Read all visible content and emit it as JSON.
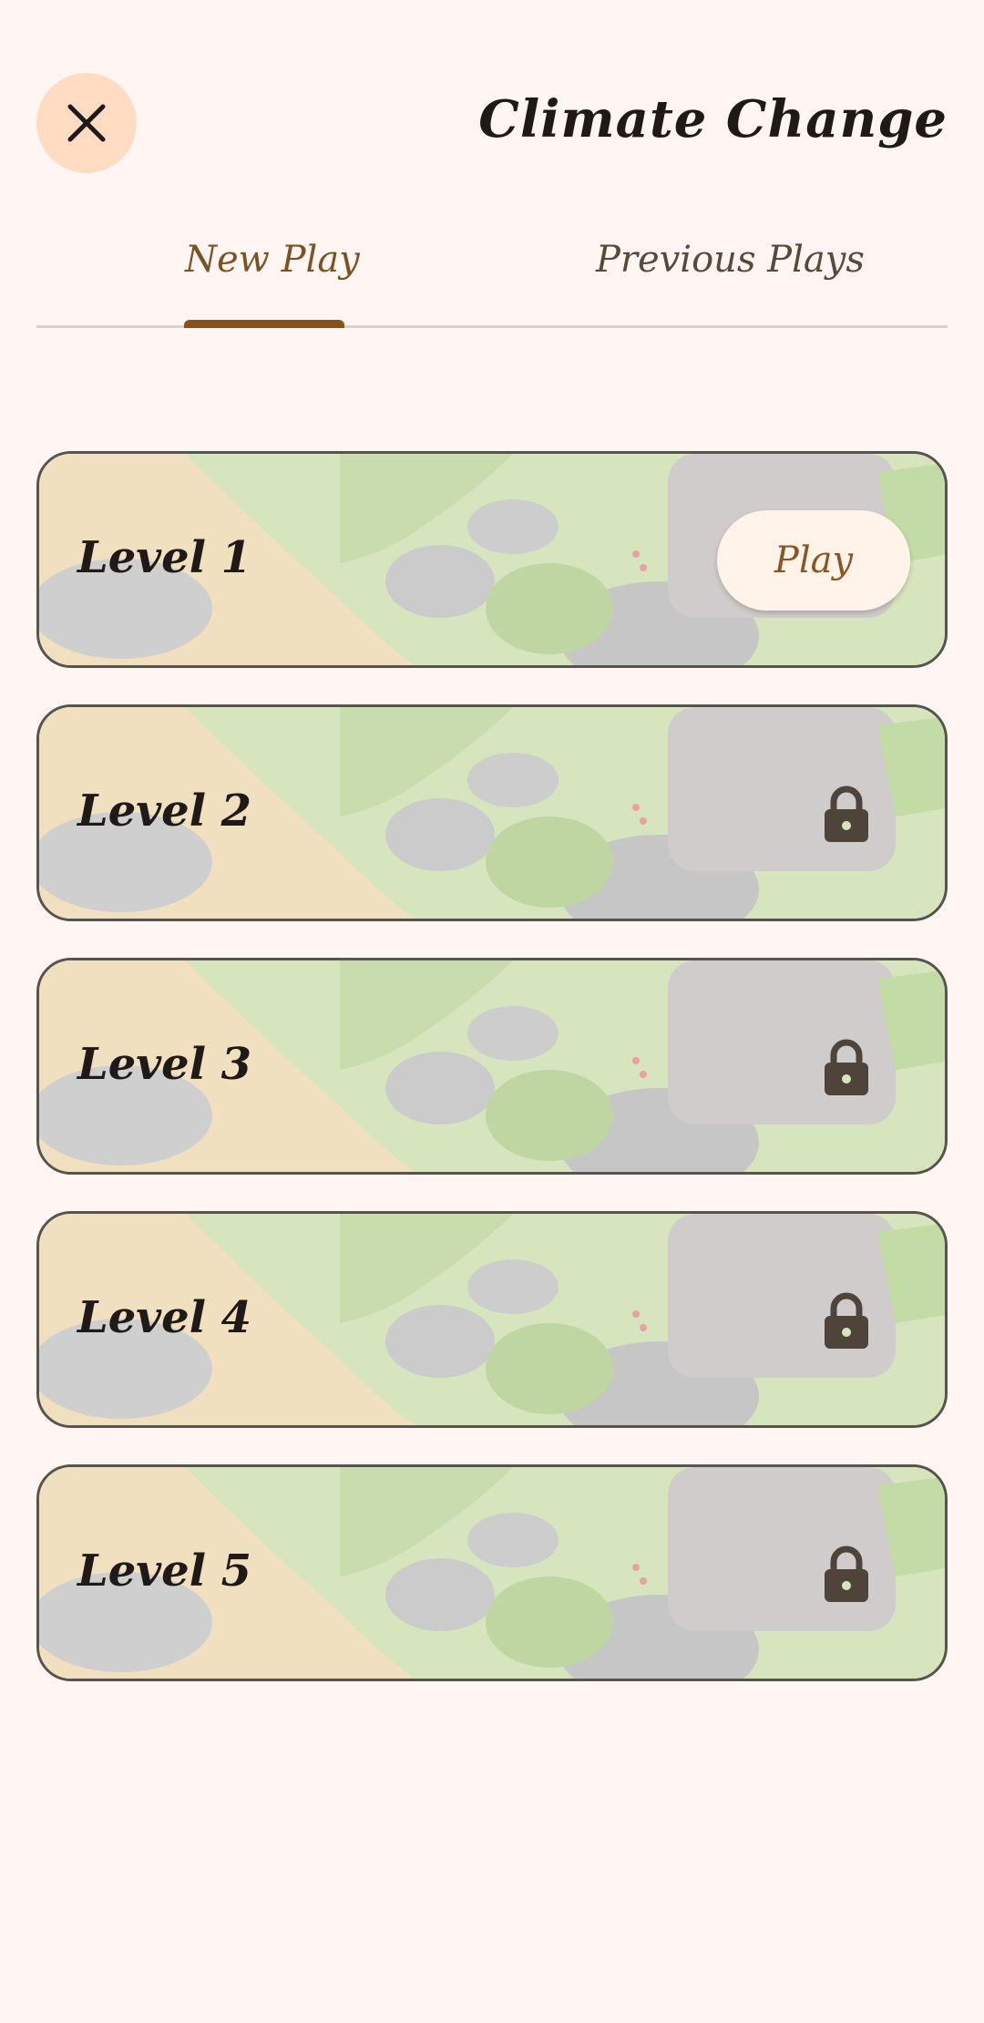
{
  "header": {
    "title": "Climate Change",
    "close_icon": "close-icon"
  },
  "tabs": [
    {
      "label": "New Play",
      "active": true
    },
    {
      "label": "Previous Plays",
      "active": false
    }
  ],
  "levels": [
    {
      "label": "Level 1",
      "locked": false,
      "action_label": "Play"
    },
    {
      "label": "Level 2",
      "locked": true,
      "icon": "lock-icon"
    },
    {
      "label": "Level 3",
      "locked": true,
      "icon": "lock-icon"
    },
    {
      "label": "Level 4",
      "locked": true,
      "icon": "lock-icon"
    },
    {
      "label": "Level 5",
      "locked": true,
      "icon": "lock-icon"
    }
  ],
  "colors": {
    "background": "#fff6f3",
    "accent": "#8b5014",
    "close_button": "#ffdcc2",
    "lock": "#4e4439"
  }
}
